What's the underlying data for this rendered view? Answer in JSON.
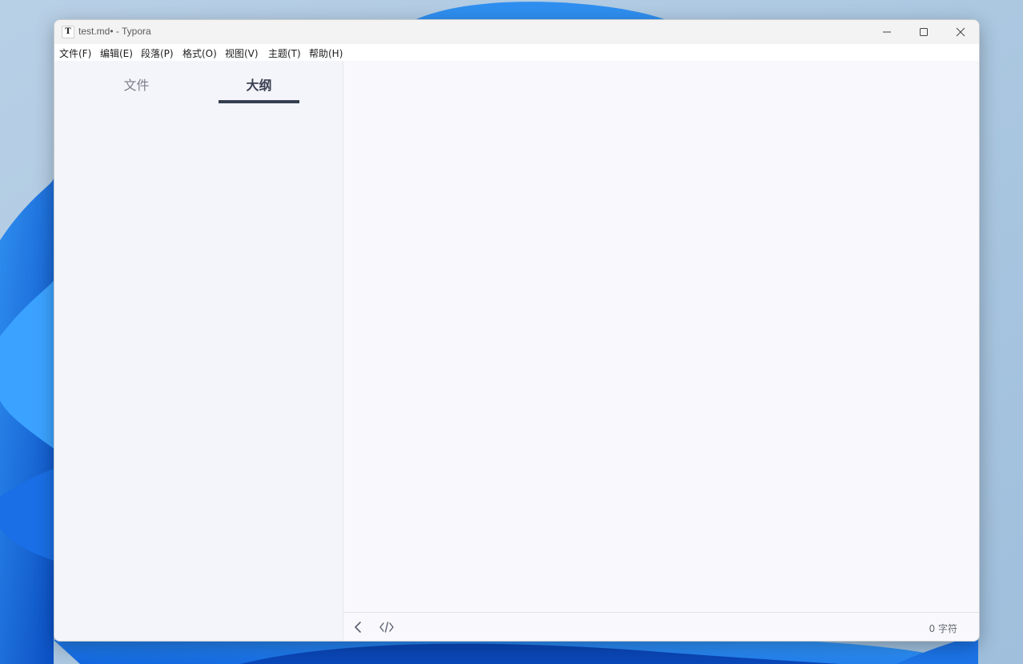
{
  "window": {
    "app_icon_letter": "T",
    "title": "test.md• - Typora"
  },
  "menubar": {
    "items": [
      "文件(F)",
      "编辑(E)",
      "段落(P)",
      "格式(O)",
      "视图(V)",
      "主题(T)",
      "帮助(H)"
    ]
  },
  "sidebar": {
    "tabs": [
      {
        "label": "文件",
        "active": false
      },
      {
        "label": "大纲",
        "active": true
      }
    ]
  },
  "footer": {
    "word_count": "0 字符"
  },
  "icons": {
    "minimize": "minimize-icon",
    "maximize": "maximize-icon",
    "close": "close-icon",
    "toggle_sidebar": "chevron-left-icon",
    "source_mode": "code-icon"
  },
  "colors": {
    "active_tab_underline": "#34404f",
    "sidebar_bg": "#f4f4fb",
    "editor_bg": "#f9f9fd"
  }
}
